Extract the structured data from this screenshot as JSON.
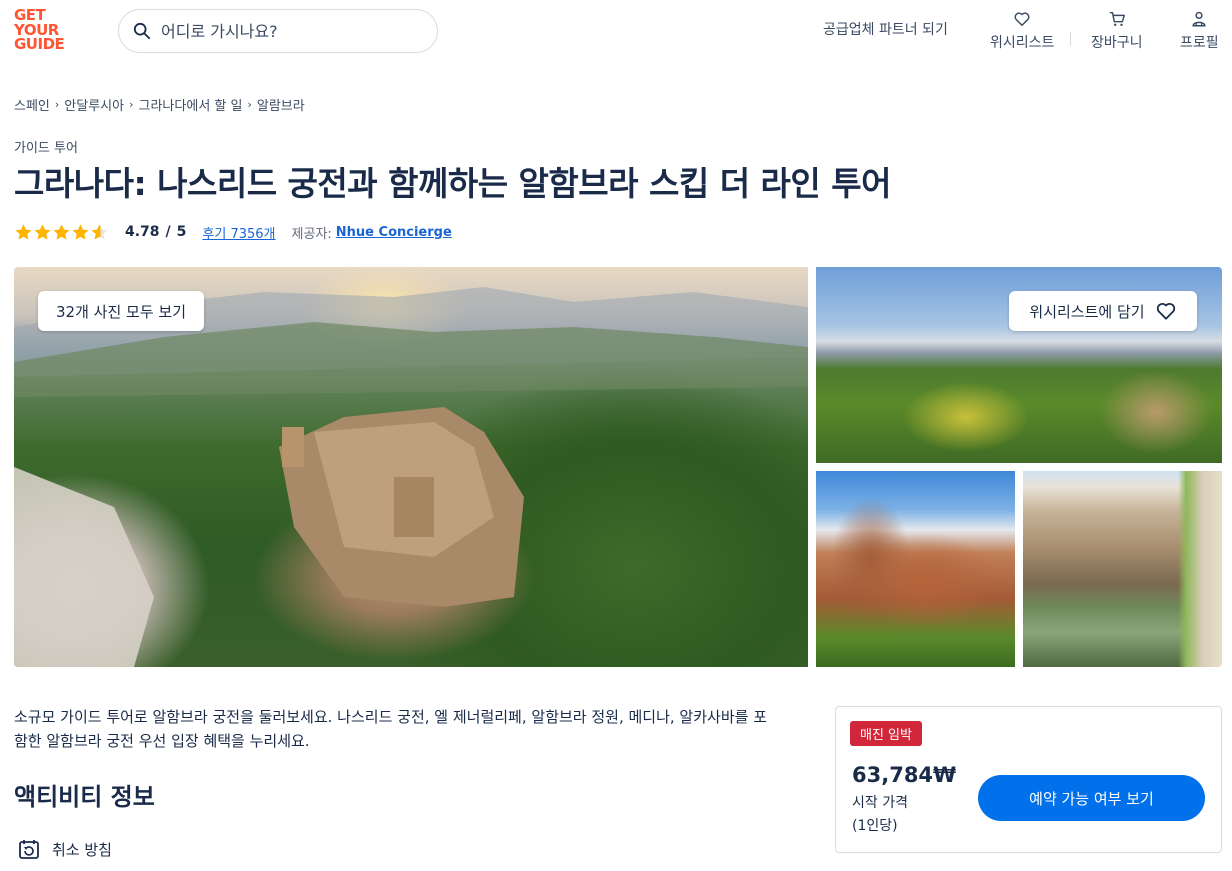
{
  "logo": {
    "line1": "GET",
    "line2": "YOUR",
    "line3": "GUIDE"
  },
  "search": {
    "placeholder": "어디로 가시나요?"
  },
  "nav": {
    "partner": "공급업체 파트너 되기",
    "wishlist": "위시리스트",
    "cart": "장바구니",
    "profile": "프로필"
  },
  "breadcrumb": [
    "스페인",
    "안달루시아",
    "그라나다에서 할 일",
    "알람브라"
  ],
  "activity": {
    "category": "가이드 투어",
    "title": "그라나다: 나스리드 궁전과 함께하는 알함브라 스킵 더 라인 투어",
    "rating": {
      "score": "4.78",
      "slash": "/",
      "max": "5",
      "stars_value": 4.78
    },
    "reviews": "후기 7356개",
    "provider_label": "제공자:",
    "provider": "Nhue Concierge"
  },
  "gallery": {
    "see_all": "32개 사진 모두 보기",
    "wishlist_add": "위시리스트에 담기"
  },
  "description": "소규모 가이드 투어로 알함브라 궁전을 둘러보세요. 나스리드 궁전, 엘 제너럴리페, 알함브라 정원, 메디나, 알카사바를 포함한 알함브라 궁전 우선 입장 혜택을 누리세요.",
  "section": {
    "title": "액티비티 정보",
    "cancellation": "취소 방침"
  },
  "booking": {
    "badge": "매진 임박",
    "price": "63,784₩",
    "price_label": "시작 가격",
    "price_unit": "(1인당)",
    "cta": "예약 가능 여부 보기"
  },
  "colors": {
    "brand": "#ff5533",
    "primary": "#0071eb",
    "text": "#1a2b49",
    "link": "#1a65d6",
    "badge": "#d1273b",
    "star": "#ffb400"
  }
}
